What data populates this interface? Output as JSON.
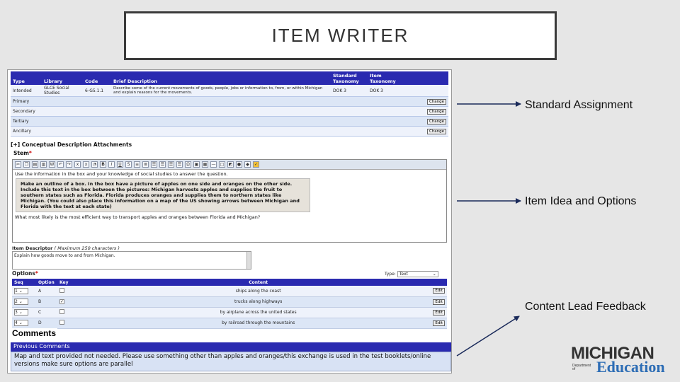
{
  "slide": {
    "title": "ITEM WRITER",
    "callouts": [
      "Standard Assignment",
      "Item Idea and Options",
      "Content Lead Feedback"
    ]
  },
  "standards": {
    "headers": [
      "Type",
      "Library",
      "Code",
      "Brief Description",
      "Standard\nTaxonomy",
      "Item\nTaxonomy"
    ],
    "rows": [
      {
        "type": "Intended",
        "library": "GLCE Social Studies",
        "code": "6-G5.1.1",
        "desc": "Describe some of the current movements of goods, people, jobs or information to, from, or within Michigan and explain reasons for the movements.",
        "std_tax": "DOK 3",
        "item_tax": "DOK 3",
        "btn": ""
      },
      {
        "type": "Primary",
        "library": "",
        "code": "",
        "desc": "",
        "std_tax": "",
        "item_tax": "",
        "btn": "Change"
      },
      {
        "type": "Secondary",
        "library": "",
        "code": "",
        "desc": "",
        "std_tax": "",
        "item_tax": "",
        "btn": "Change"
      },
      {
        "type": "Tertiary",
        "library": "",
        "code": "",
        "desc": "",
        "std_tax": "",
        "item_tax": "",
        "btn": "Change"
      },
      {
        "type": "Ancillary",
        "library": "",
        "code": "",
        "desc": "",
        "std_tax": "",
        "item_tax": "",
        "btn": "Change"
      }
    ]
  },
  "editor": {
    "section_header": "[+] Conceptual Description Attachments",
    "stem_label": "Stem",
    "required_mark": "*",
    "line1": "Use the information in the box and your knowledge of social studies to answer the question.",
    "passage": "Make an outline of a box. In the box have a picture of apples on one side and oranges on the other side. Include this text in the box between the pictures: Michigan harvests apples and supplies the fruit to southern states such as Florida. Florida produces oranges and supplies them to northern states like Michigan. (You could also place this information on a map of the US showing arrows between Michigan and Florida with the text at each state)",
    "question": "What most likely is the most efficient way to transport apples and oranges between Florida and Michigan?",
    "desc_label": "Item Descriptor",
    "desc_hint": "( Maximum 250 characters )",
    "desc_value": "Explain how goods move to and from Michigan."
  },
  "options": {
    "label": "Options",
    "type_label": "Type:",
    "type_value": "Text",
    "headers": [
      "Seq",
      "Option",
      "Key",
      "Content",
      ""
    ],
    "rows": [
      {
        "seq": "1",
        "option": "A",
        "key": false,
        "content": "ships along the coast",
        "btn": "Edit"
      },
      {
        "seq": "2",
        "option": "B",
        "key": true,
        "content": "trucks along highways",
        "btn": "Edit"
      },
      {
        "seq": "3",
        "option": "C",
        "key": false,
        "content": "by airplane across the united states",
        "btn": "Edit"
      },
      {
        "seq": "4",
        "option": "D",
        "key": false,
        "content": "by railroad through the mountains",
        "btn": "Edit"
      }
    ]
  },
  "comments": {
    "title": "Comments",
    "previous_label": "Previous Comments",
    "text": "Map and text provided not needed. Please use something other than apples and oranges/this exchange is used in the test booklets/online versions make sure options are parallel"
  },
  "logo": {
    "michigan": "MICHIGAN",
    "dept": "Department of",
    "education": "Education"
  },
  "colors": {
    "header_blue": "#2a2ab0",
    "row_light": "#dce6f6",
    "logo_blue": "#2d6db5"
  }
}
